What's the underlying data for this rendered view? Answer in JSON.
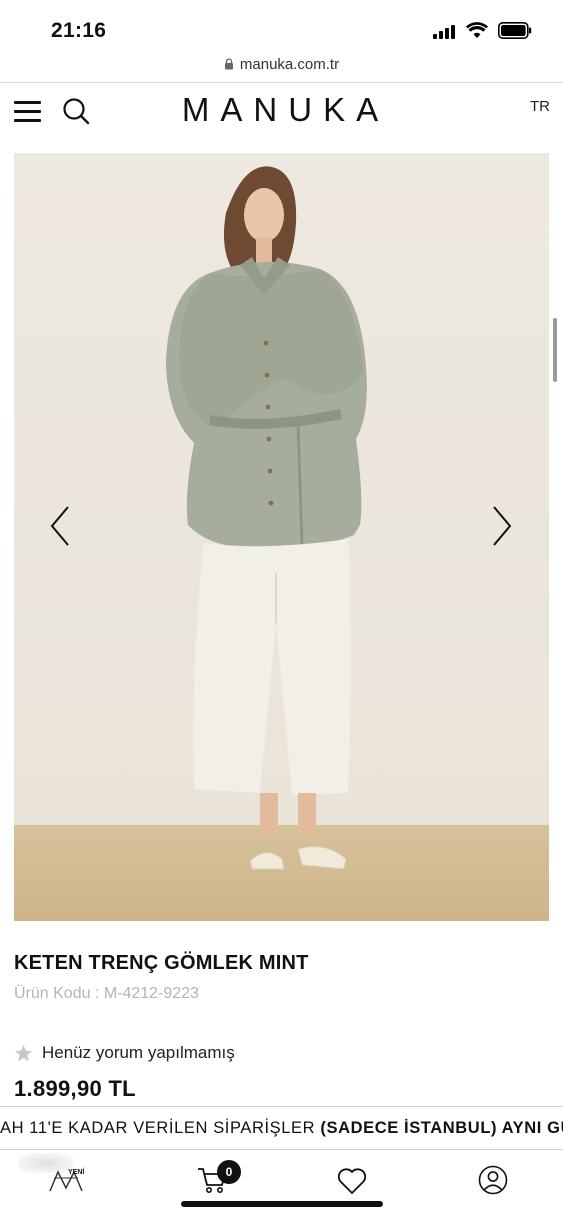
{
  "status_bar": {
    "time": "21:16"
  },
  "browser": {
    "url": "manuka.com.tr"
  },
  "header": {
    "brand": "MANUKA",
    "language": "TR"
  },
  "product": {
    "title": "KETEN TRENÇ GÖMLEK MINT",
    "code": "Ürün Kodu : M-4212-9223",
    "rating_text": "Henüz yorum yapılmamış",
    "price": "1.899,90 TL"
  },
  "banner": {
    "text_before": "AH 11'E KADAR VERİLEN SİPARİŞLER ",
    "text_bold": "(SADECE İSTANBUL) AYNI GÜN T"
  },
  "bottom_nav": {
    "new_badge": "YENİ",
    "cart_count": "0"
  },
  "colors": {
    "text": "#111111",
    "muted": "#b5b5b5",
    "wall": "#ece7de",
    "floor": "#d2b991",
    "shirt": "#a6ac9b",
    "pants": "#f1efe8"
  }
}
